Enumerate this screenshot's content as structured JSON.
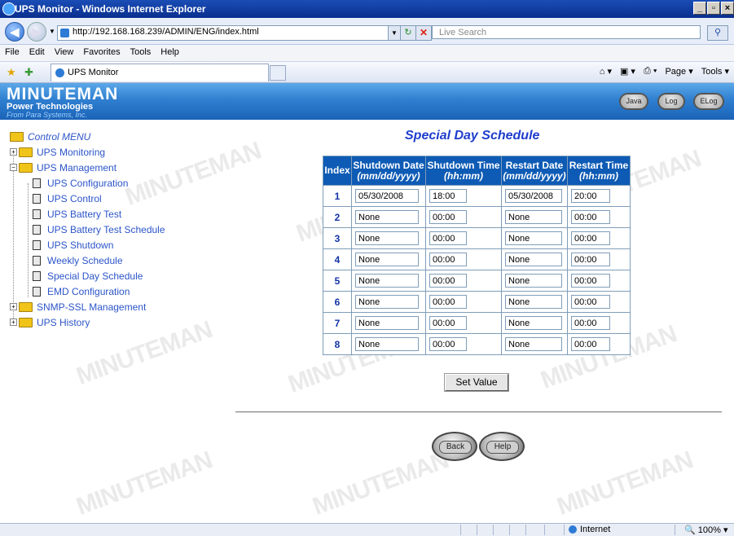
{
  "browser": {
    "window_title": "UPS Monitor - Windows Internet Explorer",
    "url": "http://192.168.168.239/ADMIN/ENG/index.html",
    "search_placeholder": "Live Search",
    "menu": [
      "File",
      "Edit",
      "View",
      "Favorites",
      "Tools",
      "Help"
    ],
    "tab_title": "UPS Monitor",
    "command_bar": [
      "Page ▾",
      "Tools ▾"
    ],
    "status_zone": "Internet",
    "status_zoom": "100%"
  },
  "header": {
    "logo_line1": "MINUTEMAN",
    "logo_line2": "Power Technologies",
    "logo_line3": "From Para Systems, Inc.",
    "buttons": [
      "Java",
      "Log",
      "ELog"
    ]
  },
  "watermark": "MINUTEMAN",
  "sidebar": {
    "root": "Control MENU",
    "items": [
      {
        "label": "UPS Monitoring",
        "level": 0,
        "type": "folder"
      },
      {
        "label": "UPS Management",
        "level": 0,
        "type": "folder-open"
      },
      {
        "label": "UPS Configuration",
        "level": 1,
        "type": "page"
      },
      {
        "label": "UPS Control",
        "level": 1,
        "type": "page"
      },
      {
        "label": "UPS Battery Test",
        "level": 1,
        "type": "page"
      },
      {
        "label": "UPS Battery Test Schedule",
        "level": 1,
        "type": "page"
      },
      {
        "label": "UPS Shutdown",
        "level": 1,
        "type": "page"
      },
      {
        "label": "Weekly Schedule",
        "level": 1,
        "type": "page"
      },
      {
        "label": "Special Day Schedule",
        "level": 1,
        "type": "page"
      },
      {
        "label": "EMD Configuration",
        "level": 1,
        "type": "page"
      },
      {
        "label": "SNMP-SSL Management",
        "level": 0,
        "type": "folder"
      },
      {
        "label": "UPS History",
        "level": 0,
        "type": "folder"
      }
    ]
  },
  "main": {
    "title": "Special Day Schedule",
    "columns": [
      {
        "label": "Index",
        "sub": ""
      },
      {
        "label": "Shutdown Date",
        "sub": "(mm/dd/yyyy)"
      },
      {
        "label": "Shutdown Time",
        "sub": "(hh:mm)"
      },
      {
        "label": "Restart Date",
        "sub": "(mm/dd/yyyy)"
      },
      {
        "label": "Restart Time",
        "sub": "(hh:mm)"
      }
    ],
    "rows": [
      {
        "index": "1",
        "shutdown_date": "05/30/2008",
        "shutdown_time": "18:00",
        "restart_date": "05/30/2008",
        "restart_time": "20:00"
      },
      {
        "index": "2",
        "shutdown_date": "None",
        "shutdown_time": "00:00",
        "restart_date": "None",
        "restart_time": "00:00"
      },
      {
        "index": "3",
        "shutdown_date": "None",
        "shutdown_time": "00:00",
        "restart_date": "None",
        "restart_time": "00:00"
      },
      {
        "index": "4",
        "shutdown_date": "None",
        "shutdown_time": "00:00",
        "restart_date": "None",
        "restart_time": "00:00"
      },
      {
        "index": "5",
        "shutdown_date": "None",
        "shutdown_time": "00:00",
        "restart_date": "None",
        "restart_time": "00:00"
      },
      {
        "index": "6",
        "shutdown_date": "None",
        "shutdown_time": "00:00",
        "restart_date": "None",
        "restart_time": "00:00"
      },
      {
        "index": "7",
        "shutdown_date": "None",
        "shutdown_time": "00:00",
        "restart_date": "None",
        "restart_time": "00:00"
      },
      {
        "index": "8",
        "shutdown_date": "None",
        "shutdown_time": "00:00",
        "restart_date": "None",
        "restart_time": "00:00"
      }
    ],
    "set_button": "Set Value",
    "back_button": "Back",
    "help_button": "Help"
  }
}
